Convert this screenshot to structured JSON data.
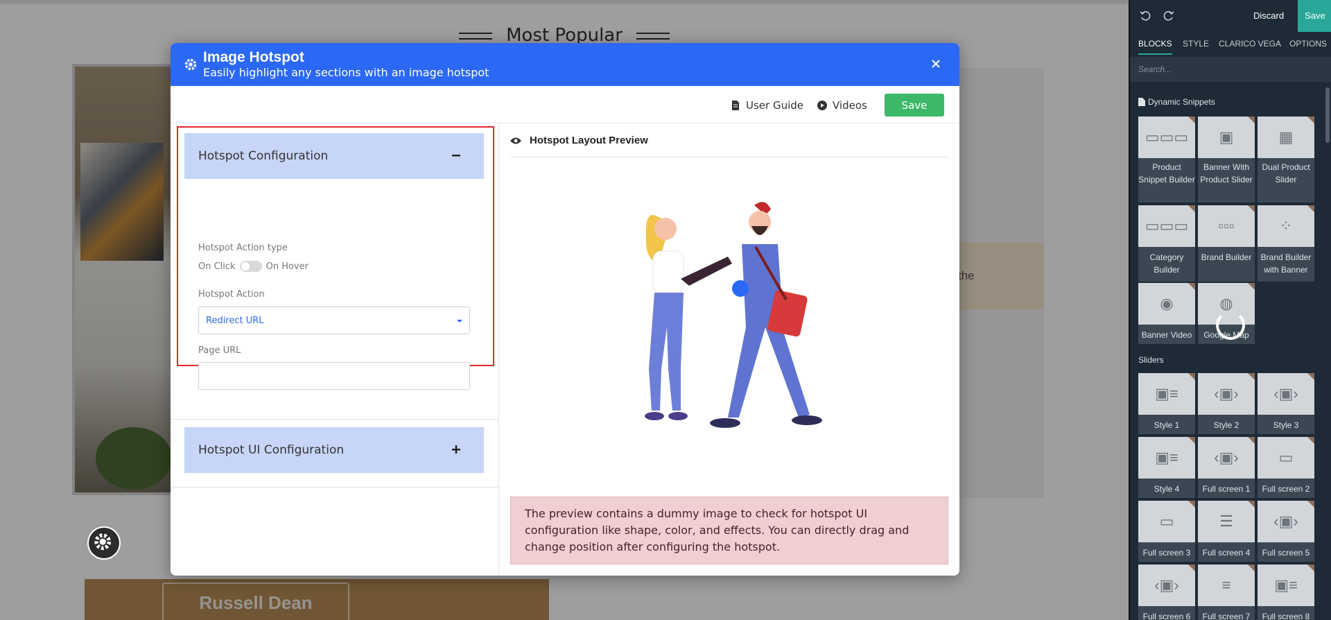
{
  "page": {
    "section_title": "Most Popular",
    "promo_text": "the",
    "brand_text": "Russell Dean"
  },
  "modal": {
    "title": "Image Hotspot",
    "subtitle": "Easily highlight any sections with an image hotspot",
    "header_color": "#2b68f5",
    "toolbar": {
      "user_guide": "User Guide",
      "videos": "Videos",
      "save": "Save"
    },
    "config": {
      "header": "Hotspot Configuration",
      "action_type_label": "Hotspot Action type",
      "on_click": "On Click",
      "on_hover": "On Hover",
      "action_label": "Hotspot Action",
      "action_value": "Redirect URL",
      "page_url_label": "Page URL",
      "page_url_value": ""
    },
    "ui_config": {
      "header": "Hotspot UI Configuration"
    },
    "preview": {
      "title": "Hotspot Layout Preview",
      "note": "The preview contains a dummy image to check for hotspot UI configuration like shape, color, and effects. You can directly drag and change position after configuring the hotspot."
    }
  },
  "editor": {
    "discard": "Discard",
    "save": "Save",
    "tabs": [
      "BLOCKS",
      "STYLE",
      "CLARICO VEGA",
      "OPTIONS"
    ],
    "search_placeholder": "Search...",
    "groups": {
      "dynamic": "Dynamic Snippets",
      "sliders": "Sliders"
    },
    "dynamic_snippets": [
      "Product Snippet Builder",
      "Banner With Product Slider",
      "Dual Product Slider",
      "Category Builder",
      "Brand Builder",
      "Brand Builder with Banner",
      "Banner Video",
      "Google Map"
    ],
    "sliders": [
      "Style 1",
      "Style 2",
      "Style 3",
      "Style 4",
      "Full screen 1",
      "Full screen 2",
      "Full screen 3",
      "Full screen 4",
      "Full screen 5",
      "Full screen 6",
      "Full screen 7",
      "Full screen 8"
    ],
    "accent_color": "#29a89a"
  }
}
